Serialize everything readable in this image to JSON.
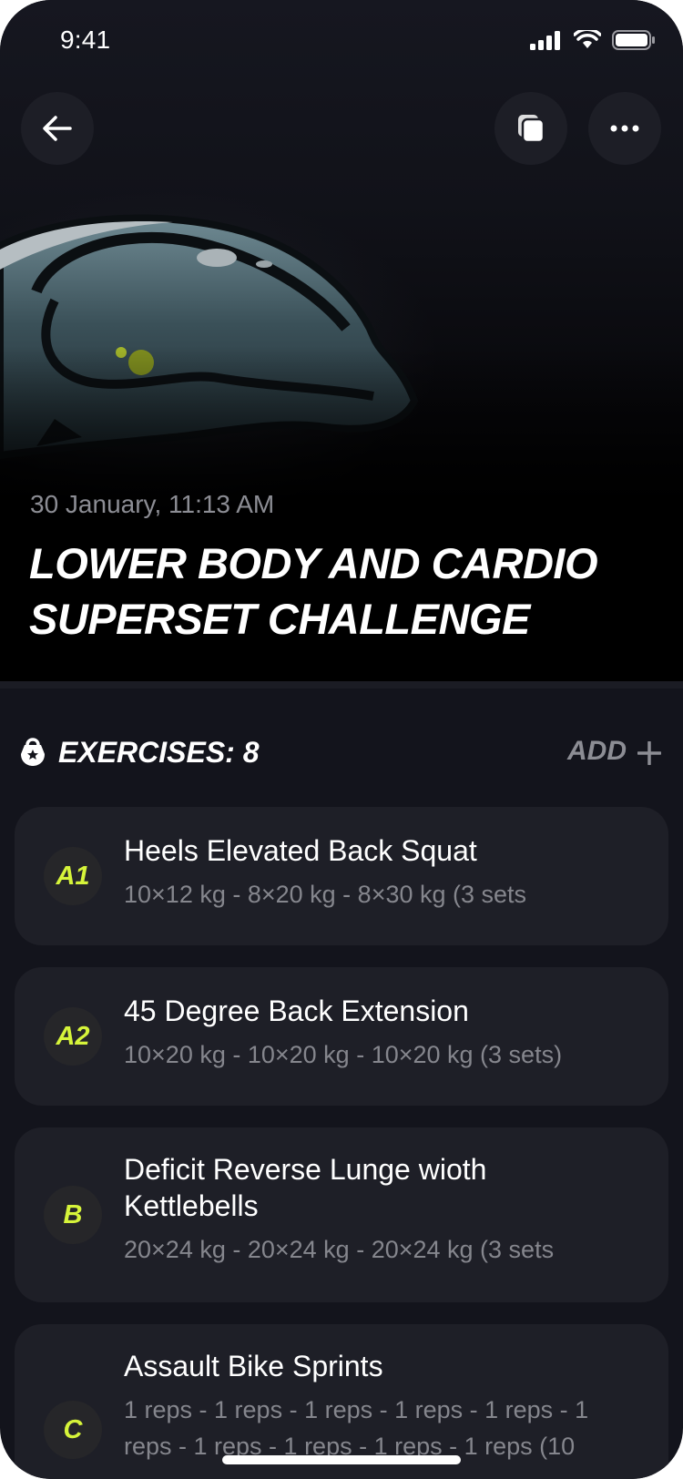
{
  "status_bar": {
    "time": "9:41"
  },
  "workout": {
    "date": "30 January, 11:13 AM",
    "title": "LOWER BODY AND CARDIO SUPERSET CHALLENGE"
  },
  "exercises_section": {
    "label": "EXERCISES: 8",
    "add_label": "ADD"
  },
  "exercises": [
    {
      "badge": "A1",
      "name": "Heels Elevated Back Squat",
      "sets": "10×12 kg - 8×20 kg - 8×30 kg (3 sets"
    },
    {
      "badge": "A2",
      "name": "45 Degree Back Extension",
      "sets": "10×20 kg - 10×20 kg - 10×20 kg (3 sets)"
    },
    {
      "badge": "B",
      "name": "Deficit Reverse Lunge wioth Kettlebells",
      "sets": "20×24 kg - 20×24 kg - 20×24 kg (3 sets"
    },
    {
      "badge": "C",
      "name": "Assault Bike Sprints",
      "sets": "1 reps - 1 reps - 1 reps - 1 reps - 1 reps - 1 reps - 1 reps - 1 reps - 1 reps - 1 reps (10"
    }
  ],
  "colors": {
    "accent": "#d6f43a",
    "background": "#13141c",
    "card": "#1e1f27"
  },
  "icons": [
    "back-arrow-icon",
    "copy-icon",
    "more-icon",
    "kettlebell-icon",
    "plus-icon",
    "signal-icon",
    "wifi-icon",
    "battery-icon"
  ]
}
